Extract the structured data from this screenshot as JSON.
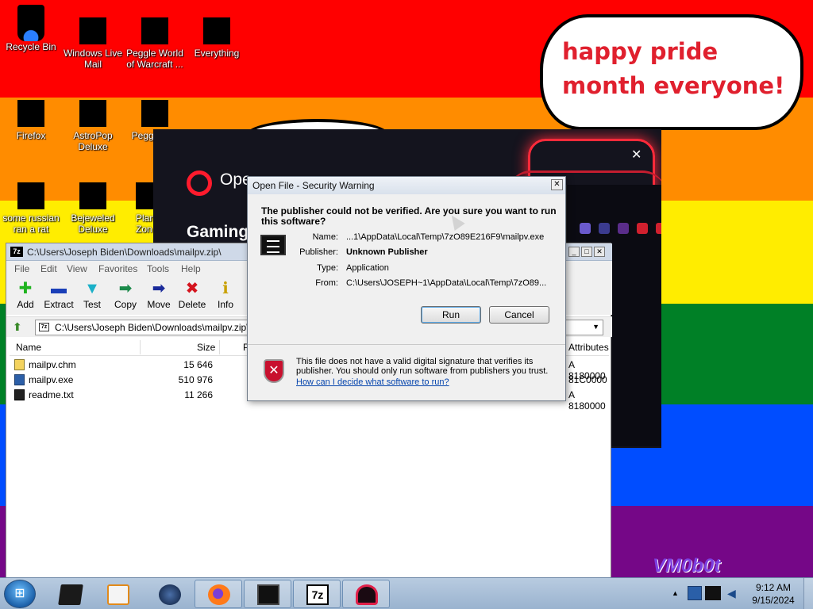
{
  "colors": {
    "stripe_red": "#ff0000",
    "stripe_orange": "#ff8c00",
    "stripe_yellow": "#ffed00",
    "stripe_green": "#008026",
    "stripe_blue": "#004dff",
    "stripe_purple": "#750787",
    "bubble_text": "#e0202e",
    "opera_red": "#ff1b2d"
  },
  "desktop": {
    "icons": [
      {
        "label": "Recycle Bin",
        "icon": "recycle-bin-icon"
      },
      {
        "label": "Windows Live Mail",
        "icon": "redacted-icon"
      },
      {
        "label": "Peggle World of Warcraft ...",
        "icon": "redacted-icon"
      },
      {
        "label": "Everything",
        "icon": "redacted-icon"
      },
      {
        "label": "Firefox",
        "icon": "redacted-icon"
      },
      {
        "label": "AstroPop Deluxe",
        "icon": "redacted-icon"
      },
      {
        "label": "Peggle Del",
        "icon": "redacted-icon"
      },
      {
        "label": "some russian ran a rat",
        "icon": "redacted-icon"
      },
      {
        "label": "Bejeweled Deluxe",
        "icon": "redacted-icon"
      },
      {
        "label": "Plan Zon",
        "icon": "redacted-icon"
      }
    ]
  },
  "bubble": {
    "text": "happy pride month everyone!"
  },
  "opera": {
    "brand": "Ope",
    "headline": "Gaming",
    "close": "✕"
  },
  "zip": {
    "title": "C:\\Users\\Joseph Biden\\Downloads\\mailpv.zip\\",
    "logo": "7z",
    "menu": [
      "File",
      "Edit",
      "View",
      "Favorites",
      "Tools",
      "Help"
    ],
    "toolbar": [
      {
        "label": "Add",
        "icon": "add-icon"
      },
      {
        "label": "Extract",
        "icon": "extract-icon"
      },
      {
        "label": "Test",
        "icon": "test-icon"
      },
      {
        "label": "Copy",
        "icon": "copy-icon"
      },
      {
        "label": "Move",
        "icon": "move-icon"
      },
      {
        "label": "Delete",
        "icon": "delete-icon"
      },
      {
        "label": "Info",
        "icon": "info-icon"
      }
    ],
    "address": "C:\\Users\\Joseph Biden\\Downloads\\mailpv.zip\\",
    "columns": {
      "name": "Name",
      "size": "Size",
      "packed": "P",
      "attributes": "Attributes"
    },
    "files": [
      {
        "name": "mailpv.chm",
        "size": "15 646",
        "attr": "A 8180000",
        "icon": "chm-file-icon"
      },
      {
        "name": "mailpv.exe",
        "size": "510 976",
        "attr": "81C0000",
        "icon": "exe-file-icon"
      },
      {
        "name": "readme.txt",
        "size": "11 266",
        "attr": "A 8180000",
        "icon": "txt-file-icon"
      }
    ]
  },
  "dialog": {
    "title": "Open File - Security Warning",
    "question": "The publisher could not be verified.  Are you sure you want to run this software?",
    "fields": {
      "name_label": "Name:",
      "name_value": "...1\\AppData\\Local\\Temp\\7zO89E216F9\\mailpv.exe",
      "publisher_label": "Publisher:",
      "publisher_value": "Unknown Publisher",
      "type_label": "Type:",
      "type_value": "Application",
      "from_label": "From:",
      "from_value": "C:\\Users\\JOSEPH~1\\AppData\\Local\\Temp\\7zO89..."
    },
    "run_label": "Run",
    "cancel_label": "Cancel",
    "warning_text": "This file does not have a valid digital signature that verifies its publisher.  You should only run software from publishers you trust.",
    "help_link": "How can I decide what software to run?"
  },
  "watermark": "VM0b0t",
  "taskbar": {
    "time": "9:12 AM",
    "date": "9/15/2024",
    "pinned": [
      "vmware-icon",
      "media-player-icon",
      "globe-icon",
      "firefox-icon",
      "window-icon",
      "7zip-icon",
      "opera-gx-icon"
    ]
  }
}
